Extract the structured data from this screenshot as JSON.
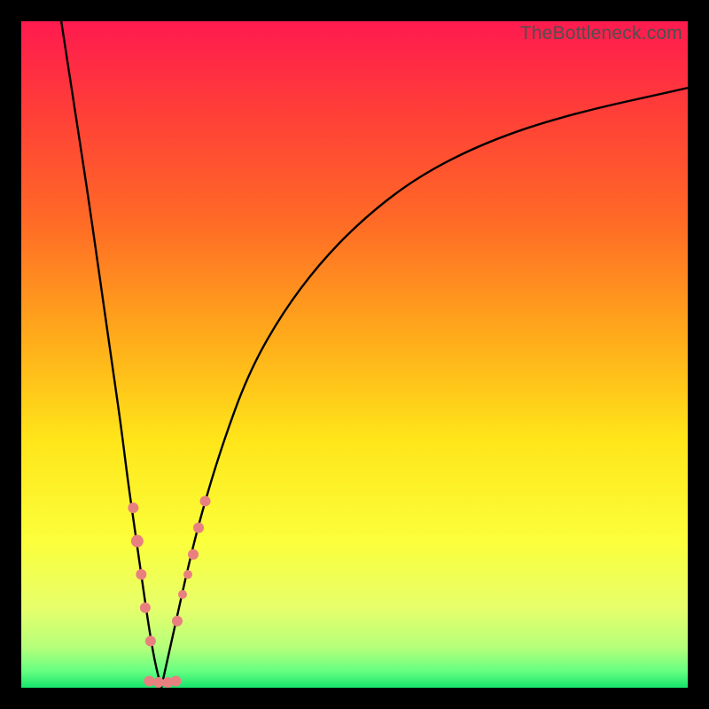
{
  "watermark": "TheBottleneck.com",
  "colors": {
    "frame": "#000000",
    "curve": "#000000",
    "marker_fill": "#e98080",
    "gradient_stops": [
      {
        "offset": 0.0,
        "color": "#ff1a4f"
      },
      {
        "offset": 0.12,
        "color": "#ff3a3a"
      },
      {
        "offset": 0.3,
        "color": "#ff6a26"
      },
      {
        "offset": 0.48,
        "color": "#ffad1a"
      },
      {
        "offset": 0.63,
        "color": "#ffe61a"
      },
      {
        "offset": 0.78,
        "color": "#fbff3b"
      },
      {
        "offset": 0.88,
        "color": "#e7ff6b"
      },
      {
        "offset": 0.94,
        "color": "#b5ff7a"
      },
      {
        "offset": 0.975,
        "color": "#66ff82"
      },
      {
        "offset": 1.0,
        "color": "#16e56b"
      }
    ]
  },
  "chart_data": {
    "type": "line",
    "title": "",
    "xlabel": "",
    "ylabel": "",
    "xlim": [
      0,
      100
    ],
    "ylim": [
      0,
      100
    ],
    "optimum_x": 21,
    "series": [
      {
        "name": "left-branch",
        "x": [
          6,
          8,
          10,
          12,
          14,
          15,
          16,
          17,
          18,
          19,
          20,
          21
        ],
        "y": [
          100,
          87,
          74,
          60,
          46,
          39,
          31,
          24,
          17,
          10,
          4,
          0
        ]
      },
      {
        "name": "right-branch",
        "x": [
          21,
          23,
          25,
          27,
          30,
          34,
          39,
          45,
          52,
          60,
          70,
          82,
          100
        ],
        "y": [
          0,
          9,
          18,
          26,
          36,
          47,
          56,
          64,
          71,
          77,
          82,
          86,
          90
        ]
      }
    ],
    "markers": [
      {
        "series": "left-branch",
        "x": 16.8,
        "y": 27,
        "r": 6
      },
      {
        "series": "left-branch",
        "x": 17.4,
        "y": 22,
        "r": 7
      },
      {
        "series": "left-branch",
        "x": 18.0,
        "y": 17,
        "r": 6
      },
      {
        "series": "left-branch",
        "x": 18.6,
        "y": 12,
        "r": 6
      },
      {
        "series": "left-branch",
        "x": 19.4,
        "y": 7,
        "r": 6
      },
      {
        "series": "right-branch",
        "x": 23.4,
        "y": 10,
        "r": 6
      },
      {
        "series": "right-branch",
        "x": 24.2,
        "y": 14,
        "r": 5
      },
      {
        "series": "right-branch",
        "x": 25.0,
        "y": 17,
        "r": 5
      },
      {
        "series": "right-branch",
        "x": 25.8,
        "y": 20,
        "r": 6
      },
      {
        "series": "right-branch",
        "x": 26.6,
        "y": 24,
        "r": 6
      },
      {
        "series": "right-branch",
        "x": 27.6,
        "y": 28,
        "r": 6
      },
      {
        "series": "bottom",
        "x": 19.2,
        "y": 1.0,
        "r": 6
      },
      {
        "series": "bottom",
        "x": 20.6,
        "y": 0.8,
        "r": 6
      },
      {
        "series": "bottom",
        "x": 22.0,
        "y": 0.8,
        "r": 6
      },
      {
        "series": "bottom",
        "x": 23.2,
        "y": 1.0,
        "r": 6
      }
    ]
  }
}
